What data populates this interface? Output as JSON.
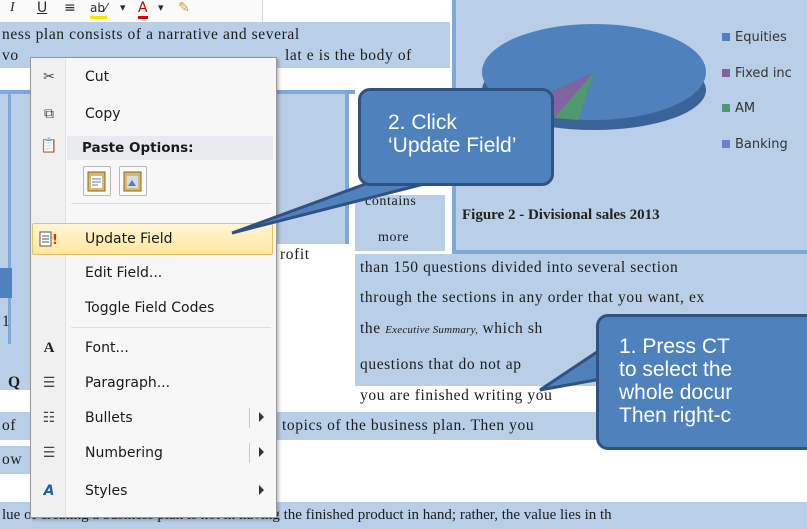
{
  "mini_toolbar": {
    "italic": "I",
    "underline": "U",
    "align": "≡",
    "highlight": "ab⁄",
    "font_color": "A",
    "format_painter": "✎"
  },
  "document": {
    "lines": [
      "ness plan consists of a narrative and several",
      "lat e is the body of",
      "contains",
      "more",
      "than 150 questions divided into several section",
      "through the sections in any order that you want, ex",
      "questions that do not ap",
      "you are finished writing you",
      "topics of the business plan. Then you",
      "lue of creating a business plan is not in having the finished product in hand; rather, the value lies in th"
    ],
    "line_the": "the",
    "line_exec": "Executive Summary,",
    "line_which": "which sh",
    "frag_vo": "vo",
    "frag_of": "of",
    "frag_ow": "ow",
    "frag_1": "1",
    "frag_q": "Q",
    "frag_profit": "rofit"
  },
  "chart": {
    "caption": "Figure 2 - Divisional sales 2013",
    "legend": [
      {
        "label": "Equities",
        "color": "#4f81bd"
      },
      {
        "label": "Fixed inc",
        "color": "#8064a2"
      },
      {
        "label": "AM",
        "color": "#4e9a6e"
      },
      {
        "label": "Banking",
        "color": "#6f7fd0"
      }
    ]
  },
  "context_menu": {
    "items": [
      {
        "label": "Cut",
        "icon": "scissors-icon"
      },
      {
        "label": "Copy",
        "icon": "copy-icon"
      },
      {
        "label": "Paste Options:",
        "icon": "paste-icon"
      },
      {
        "label": "Update Field",
        "icon": "update-field-icon"
      },
      {
        "label": "Edit Field...",
        "icon": ""
      },
      {
        "label": "Toggle Field Codes",
        "icon": ""
      },
      {
        "label": "Font...",
        "icon": "font-icon"
      },
      {
        "label": "Paragraph...",
        "icon": "paragraph-icon"
      },
      {
        "label": "Bullets",
        "icon": "bullets-icon"
      },
      {
        "label": "Numbering",
        "icon": "numbering-icon"
      },
      {
        "label": "Styles",
        "icon": "styles-icon"
      }
    ]
  },
  "callouts": {
    "step2": [
      "2. Click",
      "‘Update Field’"
    ],
    "step1": [
      "1. Press CT",
      "to select the",
      "whole docur",
      "Then right-c"
    ]
  },
  "colors": {
    "selection": "#b9cfe8",
    "callout_fill": "#4f81bd",
    "callout_border": "#2f5283",
    "highlight": "#ffe89c"
  }
}
